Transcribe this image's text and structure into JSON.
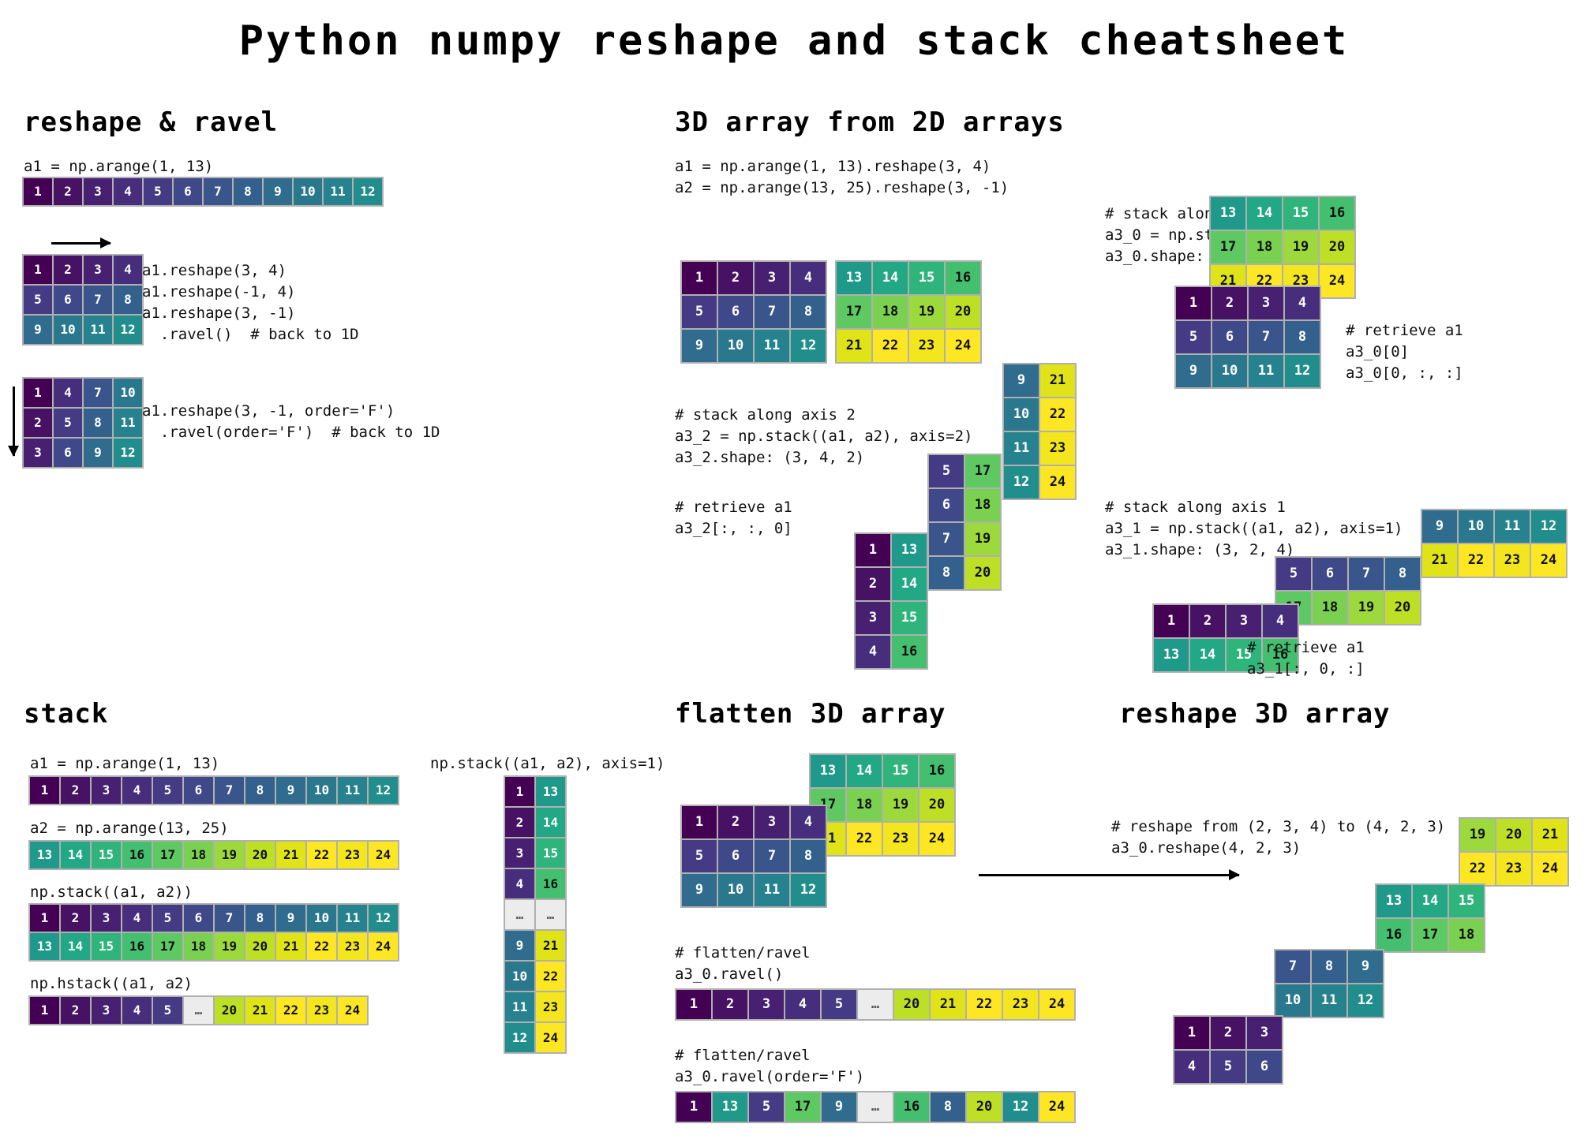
{
  "title": "Python numpy reshape and stack cheatsheet",
  "colors": {
    "viridis_1_24": [
      "#440154",
      "#471164",
      "#482071",
      "#472e7c",
      "#443b84",
      "#3f4889",
      "#3a548c",
      "#34608d",
      "#2f6c8e",
      "#2a788e",
      "#26828e",
      "#228d8d",
      "#1f998a",
      "#22a884",
      "#2fb47c",
      "#44bf70",
      "#5ec962",
      "#7ad151",
      "#9bd93c",
      "#bddf26",
      "#dfe318",
      "#fde725",
      "#f4e61e",
      "#fde725"
    ],
    "placeholder_cell": "#ececec",
    "grid_border": "#b0b0b0",
    "background": "#ffffff",
    "text_dark": "#111111",
    "text_light": "#ffffff"
  },
  "sections": {
    "reshape_ravel": {
      "heading": "reshape & ravel",
      "code_a1": "a1 = np.arange(1, 13)",
      "row_1d": [
        1,
        2,
        3,
        4,
        5,
        6,
        7,
        8,
        9,
        10,
        11,
        12
      ],
      "grid_c_rows": [
        [
          1,
          2,
          3,
          4
        ],
        [
          5,
          6,
          7,
          8
        ],
        [
          9,
          10,
          11,
          12
        ]
      ],
      "code_c": "a1.reshape(3, 4)\na1.reshape(-1, 4)\na1.reshape(3, -1)\n  .ravel()  # back to 1D",
      "grid_f_rows": [
        [
          1,
          4,
          7,
          10
        ],
        [
          2,
          5,
          8,
          11
        ],
        [
          3,
          6,
          9,
          12
        ]
      ],
      "code_f": "a1.reshape(3, -1, order='F')\n  .ravel(order='F')  # back to 1D"
    },
    "array_3d": {
      "heading": "3D array from 2D arrays",
      "code_defs": "a1 = np.arange(1, 13).reshape(3, 4)\na2 = np.arange(13, 25).reshape(3, -1)",
      "a1_rows": [
        [
          1,
          2,
          3,
          4
        ],
        [
          5,
          6,
          7,
          8
        ],
        [
          9,
          10,
          11,
          12
        ]
      ],
      "a2_rows": [
        [
          13,
          14,
          15,
          16
        ],
        [
          17,
          18,
          19,
          20
        ],
        [
          21,
          22,
          23,
          24
        ]
      ],
      "axis0": {
        "code": "# stack along axis 0\na3_0 = np.stack((a1, a2))\na3_0.shape: (2, 3, 4)",
        "back_rows": [
          [
            13,
            14,
            15,
            16
          ],
          [
            17,
            18,
            19,
            20
          ],
          [
            21,
            22,
            23,
            24
          ]
        ],
        "front_rows": [
          [
            1,
            2,
            3,
            4
          ],
          [
            5,
            6,
            7,
            8
          ],
          [
            9,
            10,
            11,
            12
          ]
        ],
        "retrieve": "# retrieve a1\na3_0[0]\na3_0[0, :, :]"
      },
      "axis2": {
        "code": "# stack along axis 2\na3_2 = np.stack((a1, a2), axis=2)\na3_2.shape: (3, 4, 2)",
        "retrieve": "# retrieve a1\na3_2[:, :, 0]",
        "panels": [
          [
            [
              9,
              21
            ],
            [
              10,
              22
            ],
            [
              11,
              23
            ],
            [
              12,
              24
            ]
          ],
          [
            [
              5,
              17
            ],
            [
              6,
              18
            ],
            [
              7,
              19
            ],
            [
              8,
              20
            ]
          ],
          [
            [
              1,
              13
            ],
            [
              2,
              14
            ],
            [
              3,
              15
            ],
            [
              4,
              16
            ]
          ]
        ]
      },
      "axis1": {
        "code": "# stack along axis 1\na3_1 = np.stack((a1, a2), axis=1)\na3_1.shape: (3, 2, 4)",
        "retrieve": "# retrieve a1\na3_1[:, 0, :]",
        "panels": [
          [
            [
              9,
              10,
              11,
              12
            ],
            [
              21,
              22,
              23,
              24
            ]
          ],
          [
            [
              5,
              6,
              7,
              8
            ],
            [
              17,
              18,
              19,
              20
            ]
          ],
          [
            [
              1,
              2,
              3,
              4
            ],
            [
              13,
              14,
              15,
              16
            ]
          ]
        ]
      }
    },
    "stack": {
      "heading": "stack",
      "code_a1": "a1 = np.arange(1, 13)",
      "row_a1": [
        1,
        2,
        3,
        4,
        5,
        6,
        7,
        8,
        9,
        10,
        11,
        12
      ],
      "code_a2": "a2 = np.arange(13, 25)",
      "row_a2": [
        13,
        14,
        15,
        16,
        17,
        18,
        19,
        20,
        21,
        22,
        23,
        24
      ],
      "code_stack": "np.stack((a1, a2))",
      "stack_rows": [
        [
          1,
          2,
          3,
          4,
          5,
          6,
          7,
          8,
          9,
          10,
          11,
          12
        ],
        [
          13,
          14,
          15,
          16,
          17,
          18,
          19,
          20,
          21,
          22,
          23,
          24
        ]
      ],
      "code_hstack": "np.hstack((a1, a2)",
      "hstack_row": [
        1,
        2,
        3,
        4,
        5,
        "…",
        20,
        21,
        22,
        23,
        24
      ],
      "code_axis1": "np.stack((a1, a2), axis=1)",
      "axis1_rows": [
        [
          1,
          13
        ],
        [
          2,
          14
        ],
        [
          3,
          15
        ],
        [
          4,
          16
        ],
        [
          "…",
          "…"
        ],
        [
          9,
          21
        ],
        [
          10,
          22
        ],
        [
          11,
          23
        ],
        [
          12,
          24
        ]
      ]
    },
    "flatten_3d": {
      "heading": "flatten 3D array",
      "back_rows": [
        [
          13,
          14,
          15,
          16
        ],
        [
          17,
          18,
          19,
          20
        ],
        [
          21,
          22,
          23,
          24
        ]
      ],
      "front_rows": [
        [
          1,
          2,
          3,
          4
        ],
        [
          5,
          6,
          7,
          8
        ],
        [
          9,
          10,
          11,
          12
        ]
      ],
      "code_ravel": "# flatten/ravel\na3_0.ravel()",
      "row_ravel": [
        1,
        2,
        3,
        4,
        5,
        "…",
        20,
        21,
        22,
        23,
        24
      ],
      "code_ravel_f": "# flatten/ravel\na3_0.ravel(order='F')",
      "row_ravel_f": [
        1,
        13,
        5,
        17,
        9,
        "…",
        16,
        8,
        20,
        12,
        24
      ]
    },
    "reshape_3d": {
      "heading": "reshape 3D array",
      "code": "# reshape from (2, 3, 4) to (4, 2, 3)\na3_0.reshape(4, 2, 3)",
      "panels": [
        [
          [
            19,
            20,
            21
          ],
          [
            22,
            23,
            24
          ]
        ],
        [
          [
            13,
            14,
            15
          ],
          [
            16,
            17,
            18
          ]
        ],
        [
          [
            7,
            8,
            9
          ],
          [
            10,
            11,
            12
          ]
        ],
        [
          [
            1,
            2,
            3
          ],
          [
            4,
            5,
            6
          ]
        ]
      ]
    }
  }
}
